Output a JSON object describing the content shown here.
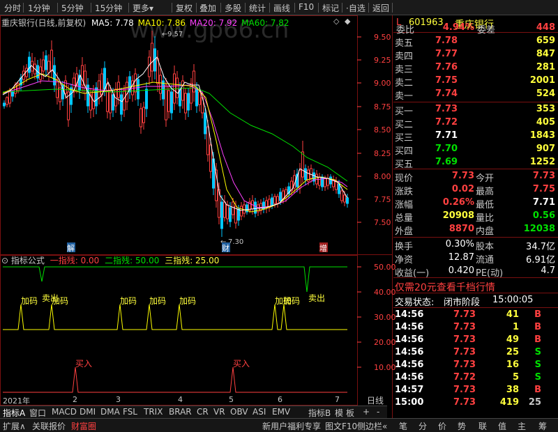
{
  "toolbar": {
    "left": [
      "分时",
      "1分钟",
      "5分钟",
      "15分钟",
      "更多▾"
    ],
    "right": [
      "复权",
      "叠加",
      "多股",
      "统计",
      "画线",
      "F10",
      "·自选",
      "返回"
    ]
  },
  "chart": {
    "title": "重庆银行(日线,前复权)",
    "ma5_label": "MA5: 7.78",
    "ma10_label": "MA10: 7.86",
    "ma20_label": "MA20: 7.92",
    "ma60_label": "MA60: 7.82",
    "watermark": "www.gp66.cn",
    "high_note": "9.57",
    "low_note": "7.30",
    "y_ticks": [
      "9.50",
      "9.25",
      "9.00",
      "8.75",
      "8.50",
      "8.25",
      "8.00",
      "7.75",
      "7.50"
    ],
    "event_marks": [
      "解",
      "财",
      "增"
    ],
    "colors": {
      "ma5": "#ffffff",
      "ma10": "#ffff00",
      "ma20": "#ff40ff",
      "ma60": "#00e000",
      "up": "#ff4040",
      "down": "#00c8ff"
    }
  },
  "indicator": {
    "title": "指标公式",
    "line1_label": "一指残: 0.00",
    "line2_label": "二指残: 50.00",
    "line3_label": "三指残: 25.00",
    "y_ticks": [
      "50.00",
      "40.00",
      "30.00",
      "20.00",
      "10.00"
    ],
    "signals": [
      "加码",
      "卖出",
      "加码",
      "加码",
      "加码",
      "加码",
      "加码",
      "加码",
      "卖出",
      "买入",
      "买入"
    ]
  },
  "x_axis": {
    "labels": [
      "2021年",
      "2",
      "3",
      "4",
      "5",
      "6",
      "7"
    ],
    "period": "日线"
  },
  "tabs": [
    "指标A",
    "窗口",
    "MACD",
    "DMI",
    "DMA",
    "FSL",
    "TRIX",
    "BRAR",
    "CR",
    "VR",
    "OBV",
    "ASI",
    "EMV",
    "指标B",
    "模",
    "板",
    "+",
    "-"
  ],
  "status_left": [
    "扩展∧",
    "关联报价",
    "财富圈"
  ],
  "status_right": [
    "新用户福利专享",
    "图文F10",
    "侧边栏«"
  ],
  "status_icons": [
    "笔",
    "分",
    "价",
    "势",
    "联",
    "值",
    "主",
    "筹"
  ],
  "quote": {
    "prefix": "L",
    "code": "601963",
    "name": "重庆银行",
    "wei_bi_label": "委比",
    "wei_bi": "4.94%",
    "wei_cha_label": "委差",
    "wei_cha": "448",
    "asks": [
      {
        "label": "卖五",
        "price": "7.78",
        "vol": "659"
      },
      {
        "label": "卖四",
        "price": "7.77",
        "vol": "847"
      },
      {
        "label": "卖三",
        "price": "7.76",
        "vol": "281"
      },
      {
        "label": "卖二",
        "price": "7.75",
        "vol": "2001"
      },
      {
        "label": "卖一",
        "price": "7.74",
        "vol": "524"
      }
    ],
    "bids": [
      {
        "label": "买一",
        "price": "7.73",
        "vol": "353"
      },
      {
        "label": "买二",
        "price": "7.72",
        "vol": "405"
      },
      {
        "label": "买三",
        "price": "7.71",
        "vol": "1843"
      },
      {
        "label": "买四",
        "price": "7.70",
        "vol": "907"
      },
      {
        "label": "买五",
        "price": "7.69",
        "vol": "1252"
      }
    ],
    "stats": [
      {
        "l1": "现价",
        "v1": "7.73",
        "l2": "今开",
        "v2": "7.73"
      },
      {
        "l1": "涨跌",
        "v1": "0.02",
        "l2": "最高",
        "v2": "7.75"
      },
      {
        "l1": "涨幅",
        "v1": "0.26%",
        "l2": "最低",
        "v2": "7.71"
      },
      {
        "l1": "总量",
        "v1": "20908",
        "l2": "量比",
        "v2": "0.56"
      },
      {
        "l1": "外盘",
        "v1": "8870",
        "l2": "内盘",
        "v2": "12038"
      }
    ],
    "stats2": [
      {
        "l1": "换手",
        "v1": "0.30%",
        "l2": "股本",
        "v2": "34.7亿"
      },
      {
        "l1": "净资",
        "v1": "12.87",
        "l2": "流通",
        "v2": "6.91亿"
      },
      {
        "l1": "收益(一)",
        "v1": "0.420",
        "l2": "PE(动)",
        "v2": "4.7"
      }
    ],
    "promo": "仅需20元查看千档行情",
    "trade_state_label": "交易状态:",
    "trade_state": "闭市阶段",
    "trade_time": "15:00:05",
    "ticks": [
      {
        "t": "14:56",
        "p": "7.73",
        "v": "41",
        "d": "B"
      },
      {
        "t": "14:56",
        "p": "7.73",
        "v": "1",
        "d": "B"
      },
      {
        "t": "14:56",
        "p": "7.73",
        "v": "49",
        "d": "B"
      },
      {
        "t": "14:56",
        "p": "7.73",
        "v": "25",
        "d": "S"
      },
      {
        "t": "14:56",
        "p": "7.73",
        "v": "16",
        "d": "S"
      },
      {
        "t": "14:56",
        "p": "7.72",
        "v": "5",
        "d": "S"
      },
      {
        "t": "14:57",
        "p": "7.73",
        "v": "38",
        "d": "B"
      },
      {
        "t": "15:00",
        "p": "7.73",
        "v": "419",
        "d": "25"
      }
    ]
  }
}
